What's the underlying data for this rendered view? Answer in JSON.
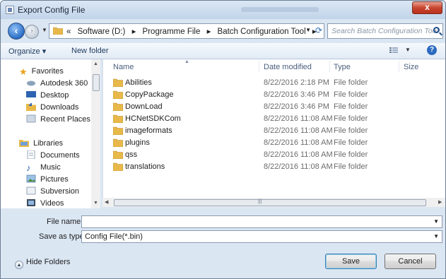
{
  "window": {
    "title": "Export Config File",
    "close_label": "x"
  },
  "nav": {
    "breadcrumb": [
      "«",
      "Software (D:)",
      "▸",
      "Programme File",
      "▸",
      "Batch Configuration Tool",
      "▸"
    ],
    "search_placeholder": "Search Batch Configuration Tool"
  },
  "toolbar": {
    "organize": "Organize ▾",
    "new_folder": "New folder"
  },
  "sidebar": {
    "favorites_header": "Favorites",
    "favorites": [
      "Autodesk 360",
      "Desktop",
      "Downloads",
      "Recent Places"
    ],
    "libraries_header": "Libraries",
    "libraries": [
      "Documents",
      "Music",
      "Pictures",
      "Subversion",
      "Videos"
    ]
  },
  "columns": {
    "name": "Name",
    "date": "Date modified",
    "type": "Type",
    "size": "Size"
  },
  "files": [
    {
      "name": "Abilities",
      "date": "8/22/2016 2:18 PM",
      "type": "File folder"
    },
    {
      "name": "CopyPackage",
      "date": "8/22/2016 3:46 PM",
      "type": "File folder"
    },
    {
      "name": "DownLoad",
      "date": "8/22/2016 3:46 PM",
      "type": "File folder"
    },
    {
      "name": "HCNetSDKCom",
      "date": "8/22/2016 11:08 AM",
      "type": "File folder"
    },
    {
      "name": "imageformats",
      "date": "8/22/2016 11:08 AM",
      "type": "File folder"
    },
    {
      "name": "plugins",
      "date": "8/22/2016 11:08 AM",
      "type": "File folder"
    },
    {
      "name": "qss",
      "date": "8/22/2016 11:08 AM",
      "type": "File folder"
    },
    {
      "name": "translations",
      "date": "8/22/2016 11:08 AM",
      "type": "File folder"
    }
  ],
  "form": {
    "file_name_label": "File name:",
    "file_name_value": "",
    "save_type_label": "Save as type:",
    "save_type_value": "Config File(*.bin)"
  },
  "footer": {
    "hide_folders": "Hide Folders",
    "save": "Save",
    "cancel": "Cancel"
  },
  "colors": {
    "accent": "#2c6bbf",
    "folder": "#e8b94a"
  }
}
